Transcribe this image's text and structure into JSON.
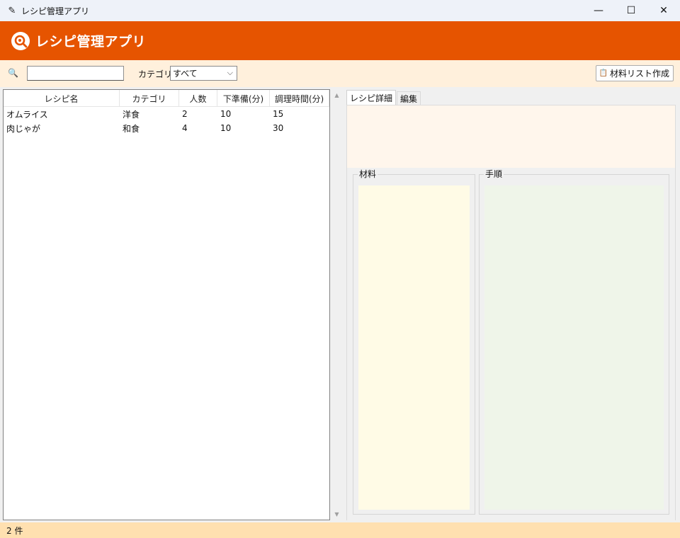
{
  "window": {
    "title": "レシピ管理アプリ",
    "app_icon": "feather-icon",
    "controls": {
      "minimize": "—",
      "maximize": "☐",
      "close": "✕"
    }
  },
  "header": {
    "title": "レシピ管理アプリ",
    "logo_icon": "search-magnifier-icon",
    "bg_color": "#e65400"
  },
  "toolbar": {
    "search_icon": "🔍",
    "search_value": "",
    "category_label": "カテゴリ:",
    "category_selected": "すべて",
    "category_chevron": "⌵",
    "list_button_icon": "📋",
    "list_button_label": "材料リスト作成"
  },
  "table": {
    "columns": [
      "レシピ名",
      "カテゴリ",
      "人数",
      "下準備(分)",
      "調理時間(分)"
    ],
    "rows": [
      [
        "オムライス",
        "洋食",
        "2",
        "10",
        "15"
      ],
      [
        "肉じゃが",
        "和食",
        "4",
        "10",
        "30"
      ]
    ]
  },
  "scrollbar": {
    "up": "▲",
    "down": "▼"
  },
  "tabs": [
    {
      "label": "レシピ詳細",
      "active": true
    },
    {
      "label": "編集",
      "active": false
    }
  ],
  "detail": {
    "ingredients_label": "材料",
    "steps_label": "手順",
    "ingredients_bg": "#fffbe6",
    "steps_bg": "#eff5e9"
  },
  "status": {
    "count_text": "2 件",
    "bg_color": "#ffe0b0"
  }
}
